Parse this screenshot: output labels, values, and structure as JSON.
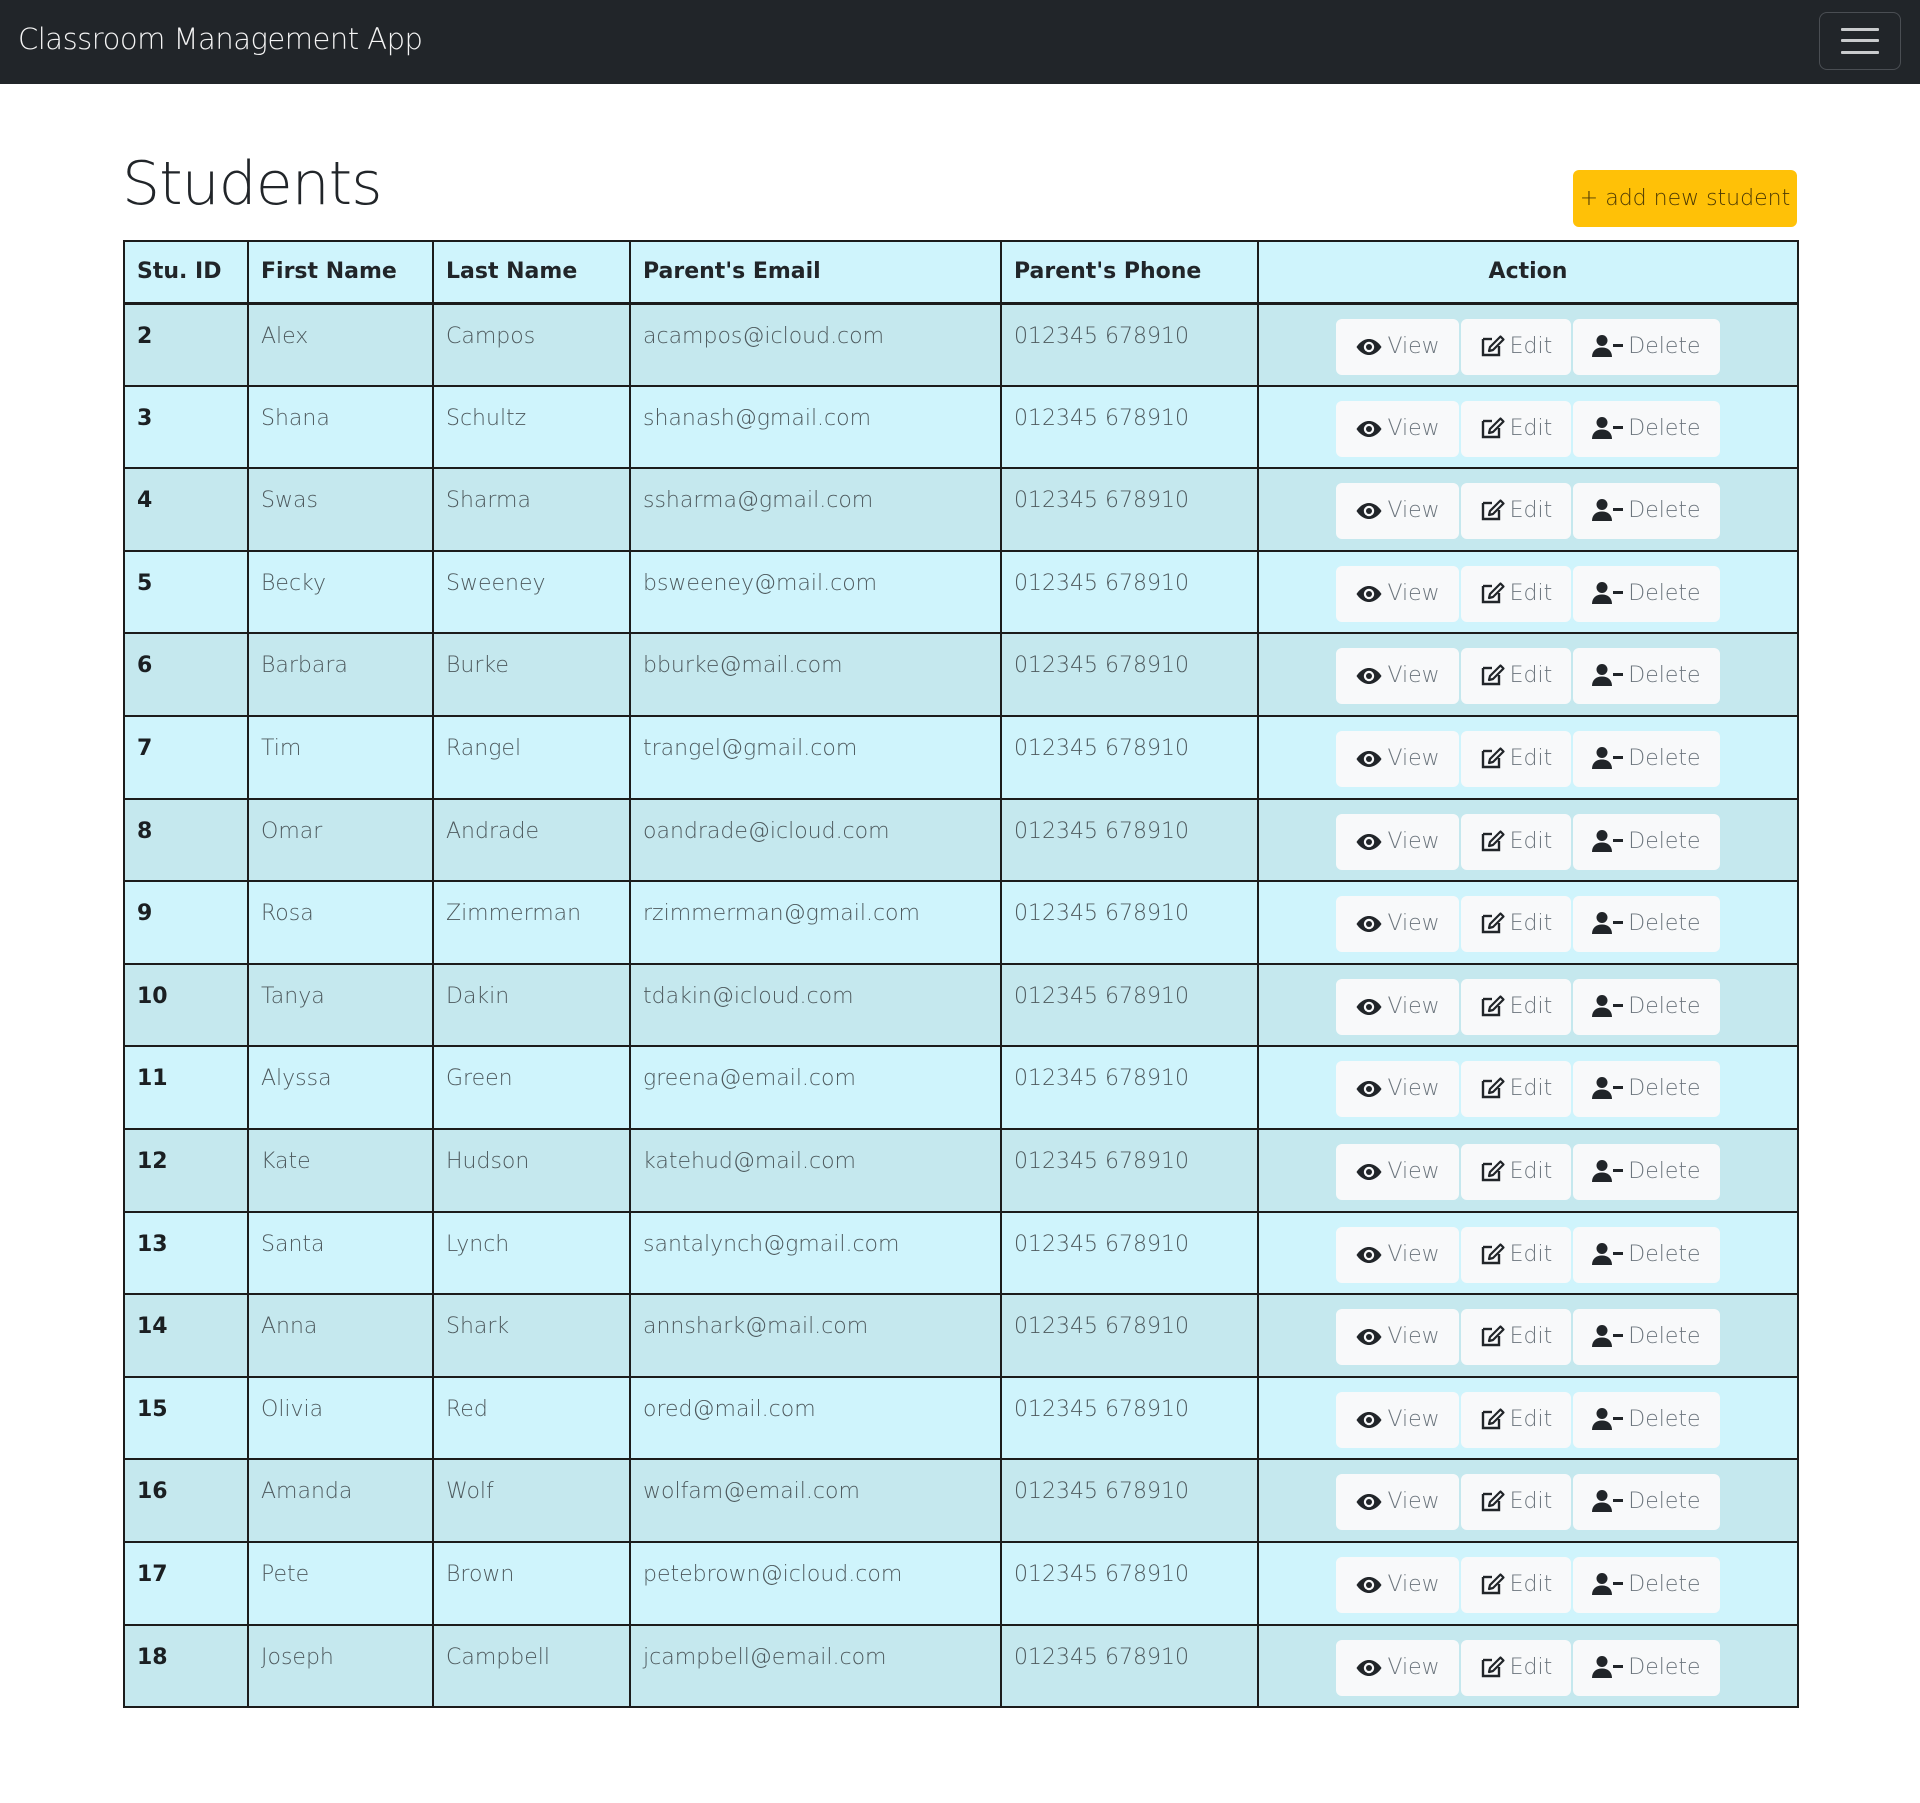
{
  "navbar": {
    "brand": "Classroom Management App",
    "toggler_icon": "hamburger-menu-icon"
  },
  "page": {
    "title": "Students",
    "add_button_label": "+ add new student"
  },
  "table": {
    "columns": [
      "Stu. ID",
      "First Name",
      "Last Name",
      "Parent's Email",
      "Parent's Phone",
      "Action"
    ],
    "action_labels": {
      "view": "View",
      "edit": "Edit",
      "delete": "Delete"
    },
    "action_icons": {
      "view": "eye-icon",
      "edit": "edit-icon",
      "delete": "user-minus-icon"
    },
    "rows": [
      {
        "id": "2",
        "first": "Alex",
        "last": "Campos",
        "email": "acampos@icloud.com",
        "phone": "012345 678910"
      },
      {
        "id": "3",
        "first": "Shana",
        "last": "Schultz",
        "email": "shanash@gmail.com",
        "phone": "012345 678910"
      },
      {
        "id": "4",
        "first": "Swas",
        "last": "Sharma",
        "email": "ssharma@gmail.com",
        "phone": "012345 678910"
      },
      {
        "id": "5",
        "first": "Becky",
        "last": "Sweeney",
        "email": "bsweeney@mail.com",
        "phone": "012345 678910"
      },
      {
        "id": "6",
        "first": "Barbara",
        "last": "Burke",
        "email": "bburke@mail.com",
        "phone": "012345 678910"
      },
      {
        "id": "7",
        "first": "Tim",
        "last": "Rangel",
        "email": "trangel@gmail.com",
        "phone": "012345 678910"
      },
      {
        "id": "8",
        "first": "Omar",
        "last": "Andrade",
        "email": "oandrade@icloud.com",
        "phone": "012345 678910"
      },
      {
        "id": "9",
        "first": "Rosa",
        "last": "Zimmerman",
        "email": "rzimmerman@gmail.com",
        "phone": "012345 678910"
      },
      {
        "id": "10",
        "first": "Tanya",
        "last": "Dakin",
        "email": "tdakin@icloud.com",
        "phone": "012345 678910"
      },
      {
        "id": "11",
        "first": "Alyssa",
        "last": "Green",
        "email": "greena@email.com",
        "phone": "012345 678910"
      },
      {
        "id": "12",
        "first": "Kate",
        "last": "Hudson",
        "email": "katehud@mail.com",
        "phone": "012345 678910"
      },
      {
        "id": "13",
        "first": "Santa",
        "last": "Lynch",
        "email": "santalynch@gmail.com",
        "phone": "012345 678910"
      },
      {
        "id": "14",
        "first": "Anna",
        "last": "Shark",
        "email": "annshark@mail.com",
        "phone": "012345 678910"
      },
      {
        "id": "15",
        "first": "Olivia",
        "last": "Red",
        "email": "ored@mail.com",
        "phone": "012345 678910"
      },
      {
        "id": "16",
        "first": "Amanda",
        "last": "Wolf",
        "email": "wolfam@email.com",
        "phone": "012345 678910"
      },
      {
        "id": "17",
        "first": "Pete",
        "last": "Brown",
        "email": "petebrown@icloud.com",
        "phone": "012345 678910"
      },
      {
        "id": "18",
        "first": "Joseph",
        "last": "Campbell",
        "email": "jcampbell@email.com",
        "phone": "012345 678910"
      }
    ]
  },
  "colors": {
    "navbar_bg": "#212529",
    "accent_warning": "#ffc107",
    "row_light": "#cff4fc",
    "row_dark": "#c5e8ee"
  }
}
